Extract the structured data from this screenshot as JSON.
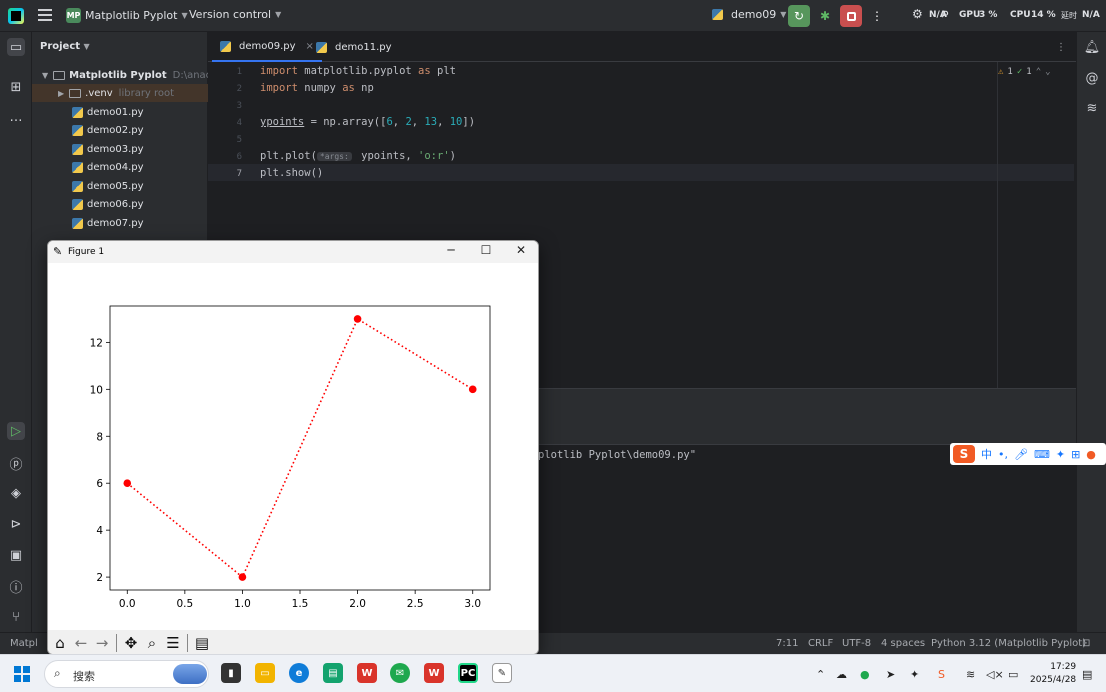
{
  "ide": {
    "project_name": "Matplotlib Pyplot",
    "project_badge": "MP",
    "version_control": "Version control",
    "run_config": "demo09",
    "status_na": "N/A",
    "gpu": "GPU",
    "gpu_value": "3 %",
    "cpu": "CPU",
    "cpu_value": "14 %",
    "net_na": "N/A",
    "net_label": "延时"
  },
  "project_panel": {
    "header": "Project",
    "root_name": "Matplotlib Pyplot",
    "root_path": "D:\\anacond",
    "venv_name": ".venv",
    "venv_note": "library root",
    "files": [
      "demo01.py",
      "demo02.py",
      "demo03.py",
      "demo04.py",
      "demo05.py",
      "demo06.py",
      "demo07.py"
    ]
  },
  "editor": {
    "tabs": [
      "demo09.py",
      "demo11.py"
    ],
    "line_numbers": [
      "1",
      "2",
      "3",
      "4",
      "5",
      "6",
      "7"
    ],
    "line1": {
      "k1": "import",
      "t1": " matplotlib.pyplot ",
      "k2": "as",
      "t2": " plt"
    },
    "line2": {
      "k1": "import",
      "t1": " numpy ",
      "k2": "as",
      "t2": " np"
    },
    "line4": {
      "var": "ypoints",
      "t1": " = np.array([",
      "n1": "6",
      "c1": ", ",
      "n2": "2",
      "c2": ", ",
      "n3": "13",
      "c3": ", ",
      "n4": "10",
      "t2": "])"
    },
    "line6": {
      "t1": "plt.plot(",
      "hint": "*args:",
      "t2": " ypoints, ",
      "str": "'o:r'",
      "t3": ")"
    },
    "line7": "plt.show()",
    "inspection": {
      "warnings": "1",
      "ok": "1"
    }
  },
  "run": {
    "output_text": "plotlib Pyplot\\demo09.py\""
  },
  "ime": {
    "lang": "中",
    "punct": "•,"
  },
  "statusbar": {
    "left": "Matpl",
    "position": "7:11",
    "line_sep": "CRLF",
    "encoding": "UTF-8",
    "indent": "4 spaces",
    "interpreter": "Python 3.12 (Matplotlib Pyplot)"
  },
  "figure": {
    "title": "Figure 1"
  },
  "taskbar": {
    "search_placeholder": "搜索",
    "time": "17:29",
    "date": "2025/4/28"
  },
  "colors": {
    "accent": "#3574f0",
    "plot_red": "#ff0000",
    "ide_bg": "#1e1f22",
    "panel_bg": "#2b2d30"
  },
  "chart_data": {
    "type": "line",
    "x": [
      0,
      1,
      2,
      3
    ],
    "series": [
      {
        "values": [
          6,
          2,
          13,
          10
        ]
      }
    ],
    "marker": "o",
    "linestyle": "dotted",
    "color": "#ff0000",
    "xlim": [
      -0.15,
      3.15
    ],
    "ylim": [
      1.45,
      13.55
    ],
    "xticks": [
      0.0,
      0.5,
      1.0,
      1.5,
      2.0,
      2.5,
      3.0
    ],
    "xtick_labels": [
      "0.0",
      "0.5",
      "1.0",
      "1.5",
      "2.0",
      "2.5",
      "3.0"
    ],
    "yticks": [
      2,
      4,
      6,
      8,
      10,
      12
    ],
    "ytick_labels": [
      "2",
      "4",
      "6",
      "8",
      "10",
      "12"
    ],
    "grid": false
  }
}
